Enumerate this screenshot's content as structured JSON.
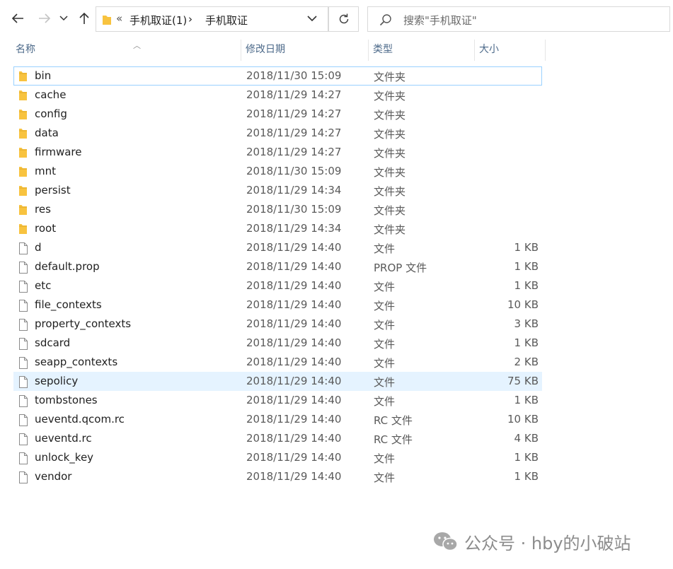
{
  "address": {
    "overflow_glyph": "«",
    "crumbs": [
      "手机取证(1)",
      "手机取证"
    ],
    "separator": "›"
  },
  "search": {
    "placeholder": "搜索\"手机取证\""
  },
  "columns": {
    "name": "名称",
    "date": "修改日期",
    "type": "类型",
    "size": "大小"
  },
  "files": [
    {
      "name": "bin",
      "date": "2018/11/30 15:09",
      "type": "文件夹",
      "size": "",
      "kind": "folder",
      "state": "focused"
    },
    {
      "name": "cache",
      "date": "2018/11/29 14:27",
      "type": "文件夹",
      "size": "",
      "kind": "folder"
    },
    {
      "name": "config",
      "date": "2018/11/29 14:27",
      "type": "文件夹",
      "size": "",
      "kind": "folder"
    },
    {
      "name": "data",
      "date": "2018/11/29 14:27",
      "type": "文件夹",
      "size": "",
      "kind": "folder"
    },
    {
      "name": "firmware",
      "date": "2018/11/29 14:27",
      "type": "文件夹",
      "size": "",
      "kind": "folder"
    },
    {
      "name": "mnt",
      "date": "2018/11/30 15:09",
      "type": "文件夹",
      "size": "",
      "kind": "folder"
    },
    {
      "name": "persist",
      "date": "2018/11/29 14:34",
      "type": "文件夹",
      "size": "",
      "kind": "folder"
    },
    {
      "name": "res",
      "date": "2018/11/30 15:09",
      "type": "文件夹",
      "size": "",
      "kind": "folder"
    },
    {
      "name": "root",
      "date": "2018/11/29 14:34",
      "type": "文件夹",
      "size": "",
      "kind": "folder"
    },
    {
      "name": "d",
      "date": "2018/11/29 14:40",
      "type": "文件",
      "size": "1 KB",
      "kind": "file"
    },
    {
      "name": "default.prop",
      "date": "2018/11/29 14:40",
      "type": "PROP 文件",
      "size": "1 KB",
      "kind": "file"
    },
    {
      "name": "etc",
      "date": "2018/11/29 14:40",
      "type": "文件",
      "size": "1 KB",
      "kind": "file"
    },
    {
      "name": "file_contexts",
      "date": "2018/11/29 14:40",
      "type": "文件",
      "size": "10 KB",
      "kind": "file"
    },
    {
      "name": "property_contexts",
      "date": "2018/11/29 14:40",
      "type": "文件",
      "size": "3 KB",
      "kind": "file"
    },
    {
      "name": "sdcard",
      "date": "2018/11/29 14:40",
      "type": "文件",
      "size": "1 KB",
      "kind": "file"
    },
    {
      "name": "seapp_contexts",
      "date": "2018/11/29 14:40",
      "type": "文件",
      "size": "2 KB",
      "kind": "file"
    },
    {
      "name": "sepolicy",
      "date": "2018/11/29 14:40",
      "type": "文件",
      "size": "75 KB",
      "kind": "file",
      "state": "selected"
    },
    {
      "name": "tombstones",
      "date": "2018/11/29 14:40",
      "type": "文件",
      "size": "1 KB",
      "kind": "file"
    },
    {
      "name": "ueventd.qcom.rc",
      "date": "2018/11/29 14:40",
      "type": "RC 文件",
      "size": "10 KB",
      "kind": "file"
    },
    {
      "name": "ueventd.rc",
      "date": "2018/11/29 14:40",
      "type": "RC 文件",
      "size": "4 KB",
      "kind": "file"
    },
    {
      "name": "unlock_key",
      "date": "2018/11/29 14:40",
      "type": "文件",
      "size": "1 KB",
      "kind": "file"
    },
    {
      "name": "vendor",
      "date": "2018/11/29 14:40",
      "type": "文件",
      "size": "1 KB",
      "kind": "file"
    }
  ],
  "watermark": {
    "text": "公众号 · hby的小破站",
    "icon": "wechat-icon"
  },
  "colors": {
    "folder": "#f8c33f",
    "selected_bg": "#e5f3ff",
    "focus_border": "#99d1ff",
    "header_text": "#4d6a8a"
  }
}
